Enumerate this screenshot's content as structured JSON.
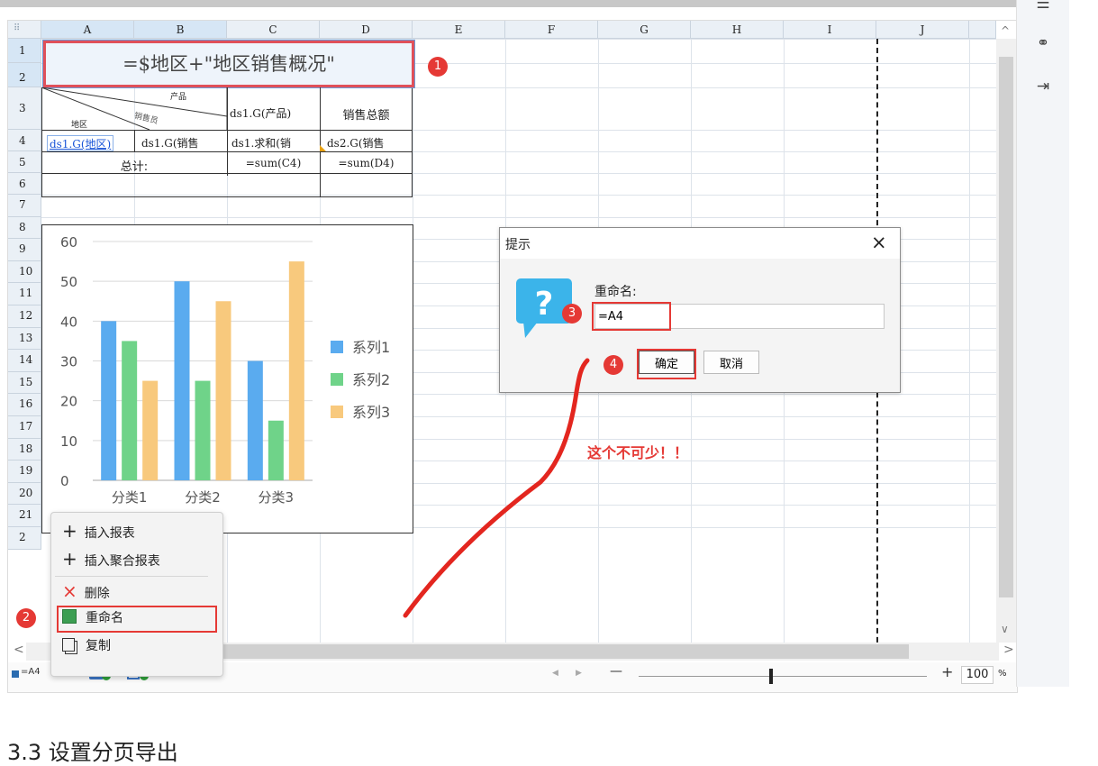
{
  "columns": [
    "A",
    "B",
    "C",
    "D",
    "E",
    "F",
    "G",
    "H",
    "I",
    "J"
  ],
  "rows": [
    "1",
    "2",
    "3",
    "4",
    "5",
    "6",
    "7",
    "8",
    "9",
    "10",
    "11",
    "12",
    "13",
    "14",
    "15",
    "16",
    "17",
    "18",
    "19",
    "20",
    "21",
    "2"
  ],
  "corner_glyph": "⠿",
  "cells": {
    "title": "=$地区+\"地区销售概况\"",
    "diag_product": "产品",
    "diag_sales": "销售员",
    "diag_region": "地区",
    "c3": "ds1.G(产品)",
    "d3": "销售总额",
    "a4": "ds1.G(地区)",
    "b4": "ds1.G(销售",
    "c4": "ds1.求和(销",
    "d4": "ds2.G(销售",
    "a5": "总计:",
    "c5": "=sum(C4)",
    "d5": "=sum(D4)"
  },
  "chart_data": {
    "type": "bar",
    "categories": [
      "分类1",
      "分类2",
      "分类3"
    ],
    "series": [
      {
        "name": "系列1",
        "values": [
          40,
          50,
          30
        ],
        "color": "#5aabef"
      },
      {
        "name": "系列2",
        "values": [
          35,
          25,
          15
        ],
        "color": "#6fd389"
      },
      {
        "name": "系列3",
        "values": [
          25,
          45,
          55
        ],
        "color": "#f8c97d"
      }
    ],
    "yticks": [
      "0",
      "10",
      "20",
      "30",
      "40",
      "50",
      "60"
    ],
    "ylim": [
      0,
      60
    ],
    "legend": "right",
    "grid": true
  },
  "dialog": {
    "title": "提示",
    "close_glyph": "×",
    "label": "重命名:",
    "input_value": "=A4",
    "ok": "确定",
    "cancel": "取消"
  },
  "annotation": "这个不可少！！",
  "badges": [
    "1",
    "2",
    "3",
    "4"
  ],
  "context_menu": {
    "items": [
      {
        "glyph": "+",
        "label": "插入报表"
      },
      {
        "glyph": "+",
        "label": "插入聚合报表"
      },
      {
        "glyph": "×",
        "label": "删除"
      },
      {
        "glyph": "",
        "label": "重命名"
      },
      {
        "glyph": "",
        "label": "复制"
      }
    ]
  },
  "sheet_tab": "=A4",
  "zoom": {
    "minus": "—",
    "plus": "+",
    "value": "100",
    "unit": "%"
  },
  "nav": {
    "left": "◀",
    "right": "▶",
    "scroll_left": "<",
    "scroll_right": ">",
    "scroll_up": "^",
    "scroll_down": "∨"
  },
  "bottom_text": "3.3 设置分页导出",
  "colors": {
    "accent_red": "#e53935",
    "header_bg": "#eaf0f6",
    "selected_header": "#d6e6f5"
  }
}
